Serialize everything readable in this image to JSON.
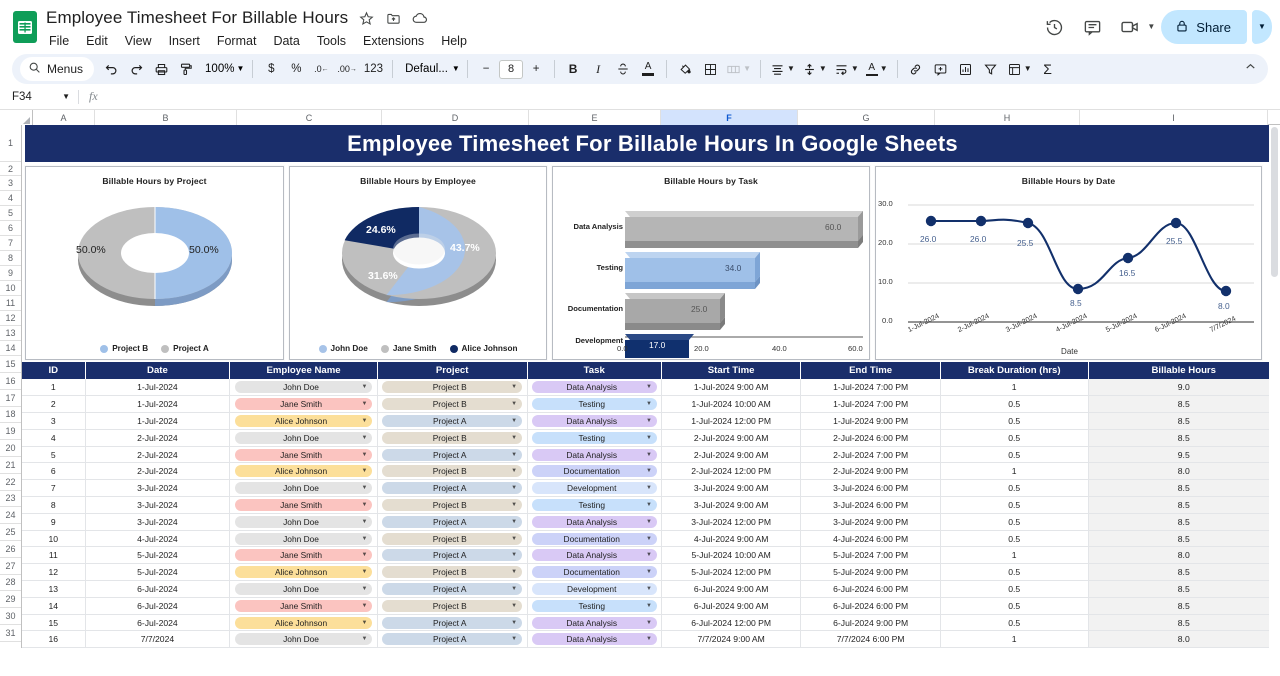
{
  "app": {
    "doc_title": "Employee Timesheet For Billable Hours",
    "logo_name": "google-sheets-logo",
    "menus": [
      "File",
      "Edit",
      "View",
      "Insert",
      "Format",
      "Data",
      "Tools",
      "Extensions",
      "Help"
    ],
    "title_icons": [
      "star-icon",
      "move-to-folder-icon",
      "cloud-saved-icon"
    ],
    "right_icons": [
      "version-history-icon",
      "comment-icon",
      "video-call-icon"
    ],
    "share_label": "Share",
    "share_icon": "lock-icon"
  },
  "toolbar": {
    "menus_label": "Menus",
    "search_icon": "search-icon",
    "undo": "undo-icon",
    "redo": "redo-icon",
    "print": "print-icon",
    "paint_format": "paint-format-icon",
    "zoom_value": "100%",
    "currency": "$",
    "percent": "%",
    "decimal_decrease": ".0",
    "decimal_increase": ".00",
    "more_formats": "123",
    "font_name": "Defaul...",
    "font_size_minus": "−",
    "font_size": "8",
    "font_size_plus": "+",
    "bold": "B",
    "italic": "I",
    "strikethrough": "strikethrough-icon",
    "text_color": "A",
    "fill_color": "fill-color-icon",
    "borders": "borders-icon",
    "merge_cells": "merge-cells-icon",
    "horizontal_align": "horizontal-align-icon",
    "vertical_align": "vertical-align-icon",
    "text_wrap": "text-wrapping-icon",
    "text_rotation": "text-rotation-icon",
    "insert_link": "insert-link-icon",
    "insert_comment": "insert-comment-icon",
    "insert_chart": "insert-chart-icon",
    "create_filter": "filter-icon",
    "functions_sigma": "Σ",
    "collapse": "collapse-toolbar-icon"
  },
  "formula_bar": {
    "cell_ref": "F34",
    "fx": "fx",
    "value": "",
    "placeholder": ""
  },
  "grid": {
    "columns": [
      "A",
      "B",
      "C",
      "D",
      "E",
      "F",
      "G",
      "H",
      "I"
    ],
    "selected_column": "F",
    "row_numbers": [
      1,
      2,
      3,
      4,
      5,
      6,
      7,
      8,
      9,
      10,
      11,
      12,
      13,
      14,
      15,
      16,
      17,
      18,
      19,
      20,
      21,
      22,
      23,
      24,
      25,
      26,
      27,
      28,
      29,
      30,
      31
    ],
    "banner_title": "Employee Timesheet For Billable Hours In Google Sheets",
    "banner_color": "#1a2e6b"
  },
  "chart_data": [
    {
      "type": "pie",
      "title": "Billable Hours by Project",
      "labels": [
        "Project B",
        "Project A"
      ],
      "values": [
        50.0,
        50.0
      ],
      "data_labels": [
        "50.0%",
        "50.0%"
      ],
      "colors": [
        "#9fc0e8",
        "#b8b8b8"
      ],
      "legend": "bottom",
      "donut": true
    },
    {
      "type": "pie",
      "title": "Billable Hours by Employee",
      "labels": [
        "John Doe",
        "Jane Smith",
        "Alice Johnson"
      ],
      "values": [
        43.7,
        31.6,
        24.6
      ],
      "data_labels": [
        "43.7%",
        "31.6%",
        "24.6%"
      ],
      "colors": [
        "#a7c3e8",
        "#bfbfbf",
        "#102a63"
      ],
      "legend": "bottom",
      "donut": true
    },
    {
      "type": "bar",
      "title": "Billable Hours by Task",
      "orientation": "horizontal",
      "categories": [
        "Data Analysis",
        "Testing",
        "Documentation",
        "Development"
      ],
      "values": [
        60.0,
        34.0,
        25.0,
        17.0
      ],
      "data_labels": [
        "60.0",
        "34.0",
        "25.0",
        "17.0"
      ],
      "colors": [
        "#b5b5b5",
        "#9fc0e8",
        "#a8a8a8",
        "#10306e"
      ],
      "xlabel": "",
      "ylabel": "",
      "xticks": [
        "0.0",
        "20.0",
        "40.0",
        "60.0"
      ],
      "xlim": [
        0,
        60
      ]
    },
    {
      "type": "line",
      "title": "Billable Hours by Date",
      "x": [
        "1-Jul-2024",
        "2-Jul-2024",
        "3-Jul-2024",
        "4-Jul-2024",
        "5-Jul-2024",
        "6-Jul-2024",
        "7/7/2024"
      ],
      "values": [
        26.0,
        26.0,
        25.5,
        8.5,
        16.5,
        25.5,
        8.0
      ],
      "data_labels": [
        "26.0",
        "26.0",
        "25.5",
        "8.5",
        "16.5",
        "25.5",
        "8.0"
      ],
      "xlabel": "Date",
      "ylabel": "",
      "yticks": [
        "0.0",
        "10.0",
        "20.0",
        "30.0"
      ],
      "ylim": [
        0,
        30
      ],
      "color": "#12306b",
      "grid": true,
      "smooth": true
    }
  ],
  "table": {
    "headers": [
      "ID",
      "Date",
      "Employee Name",
      "Project",
      "Task",
      "Start Time",
      "End Time",
      "Break Duration (hrs)",
      "Billable Hours"
    ],
    "chip_colors": {
      "John Doe": "#e4e4e4",
      "Jane Smith": "#fbc4c0",
      "Alice Johnson": "#fcdf9a",
      "Project A": "#ccd9e8",
      "Project B": "#e4ddd0",
      "Data Analysis": "#d9c9f5",
      "Testing": "#c7e0fb",
      "Documentation": "#ccd2f8",
      "Development": "#d8e5fb"
    },
    "rows": [
      {
        "id": "1",
        "date": "1-Jul-2024",
        "employee": "John Doe",
        "project": "Project B",
        "task": "Data Analysis",
        "start": "1-Jul-2024 9:00 AM",
        "end": "1-Jul-2024 7:00 PM",
        "break": "1",
        "hours": "9.0"
      },
      {
        "id": "2",
        "date": "1-Jul-2024",
        "employee": "Jane Smith",
        "project": "Project B",
        "task": "Testing",
        "start": "1-Jul-2024 10:00 AM",
        "end": "1-Jul-2024 7:00 PM",
        "break": "0.5",
        "hours": "8.5"
      },
      {
        "id": "3",
        "date": "1-Jul-2024",
        "employee": "Alice Johnson",
        "project": "Project A",
        "task": "Data Analysis",
        "start": "1-Jul-2024 12:00 PM",
        "end": "1-Jul-2024 9:00 PM",
        "break": "0.5",
        "hours": "8.5"
      },
      {
        "id": "4",
        "date": "2-Jul-2024",
        "employee": "John Doe",
        "project": "Project B",
        "task": "Testing",
        "start": "2-Jul-2024 9:00 AM",
        "end": "2-Jul-2024 6:00 PM",
        "break": "0.5",
        "hours": "8.5"
      },
      {
        "id": "5",
        "date": "2-Jul-2024",
        "employee": "Jane Smith",
        "project": "Project A",
        "task": "Data Analysis",
        "start": "2-Jul-2024 9:00 AM",
        "end": "2-Jul-2024 7:00 PM",
        "break": "0.5",
        "hours": "9.5"
      },
      {
        "id": "6",
        "date": "2-Jul-2024",
        "employee": "Alice Johnson",
        "project": "Project B",
        "task": "Documentation",
        "start": "2-Jul-2024 12:00 PM",
        "end": "2-Jul-2024 9:00 PM",
        "break": "1",
        "hours": "8.0"
      },
      {
        "id": "7",
        "date": "3-Jul-2024",
        "employee": "John Doe",
        "project": "Project A",
        "task": "Development",
        "start": "3-Jul-2024 9:00 AM",
        "end": "3-Jul-2024 6:00 PM",
        "break": "0.5",
        "hours": "8.5"
      },
      {
        "id": "8",
        "date": "3-Jul-2024",
        "employee": "Jane Smith",
        "project": "Project B",
        "task": "Testing",
        "start": "3-Jul-2024 9:00 AM",
        "end": "3-Jul-2024 6:00 PM",
        "break": "0.5",
        "hours": "8.5"
      },
      {
        "id": "9",
        "date": "3-Jul-2024",
        "employee": "John Doe",
        "project": "Project A",
        "task": "Data Analysis",
        "start": "3-Jul-2024 12:00 PM",
        "end": "3-Jul-2024 9:00 PM",
        "break": "0.5",
        "hours": "8.5"
      },
      {
        "id": "10",
        "date": "4-Jul-2024",
        "employee": "John Doe",
        "project": "Project B",
        "task": "Documentation",
        "start": "4-Jul-2024 9:00 AM",
        "end": "4-Jul-2024 6:00 PM",
        "break": "0.5",
        "hours": "8.5"
      },
      {
        "id": "11",
        "date": "5-Jul-2024",
        "employee": "Jane Smith",
        "project": "Project A",
        "task": "Data Analysis",
        "start": "5-Jul-2024 10:00 AM",
        "end": "5-Jul-2024 7:00 PM",
        "break": "1",
        "hours": "8.0"
      },
      {
        "id": "12",
        "date": "5-Jul-2024",
        "employee": "Alice Johnson",
        "project": "Project B",
        "task": "Documentation",
        "start": "5-Jul-2024 12:00 PM",
        "end": "5-Jul-2024 9:00 PM",
        "break": "0.5",
        "hours": "8.5"
      },
      {
        "id": "13",
        "date": "6-Jul-2024",
        "employee": "John Doe",
        "project": "Project A",
        "task": "Development",
        "start": "6-Jul-2024 9:00 AM",
        "end": "6-Jul-2024 6:00 PM",
        "break": "0.5",
        "hours": "8.5"
      },
      {
        "id": "14",
        "date": "6-Jul-2024",
        "employee": "Jane Smith",
        "project": "Project B",
        "task": "Testing",
        "start": "6-Jul-2024 9:00 AM",
        "end": "6-Jul-2024 6:00 PM",
        "break": "0.5",
        "hours": "8.5"
      },
      {
        "id": "15",
        "date": "6-Jul-2024",
        "employee": "Alice Johnson",
        "project": "Project A",
        "task": "Data Analysis",
        "start": "6-Jul-2024 12:00 PM",
        "end": "6-Jul-2024 9:00 PM",
        "break": "0.5",
        "hours": "8.5"
      },
      {
        "id": "16",
        "date": "7/7/2024",
        "employee": "John Doe",
        "project": "Project A",
        "task": "Data Analysis",
        "start": "7/7/2024 9:00 AM",
        "end": "7/7/2024 6:00 PM",
        "break": "1",
        "hours": "8.0"
      }
    ]
  }
}
